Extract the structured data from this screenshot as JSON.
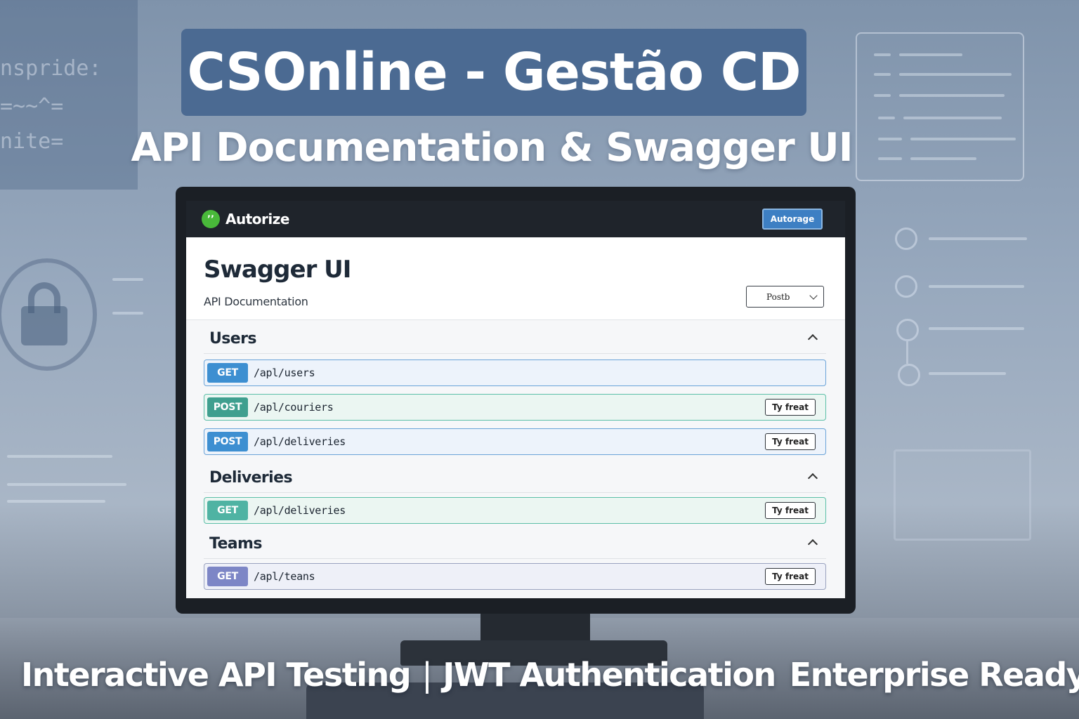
{
  "headline": {
    "title": "CSOnline - Gestão CD",
    "subtitle": "API Documentation & Swagger UI"
  },
  "features": {
    "item1": "Interactive API Testing",
    "separator": "|",
    "item2": "JWT Authentication",
    "item3": "Enterprise Ready"
  },
  "background": {
    "code_lines": [
      "nspride:",
      "=~~^=",
      "nite="
    ]
  },
  "swagger": {
    "brand": "Autorize",
    "authorize_label": "Autorage",
    "title": "Swagger UI",
    "description": "API Documentation",
    "server_value": "Postb",
    "try_label": "Ty freat",
    "sections": [
      {
        "name": "Users",
        "operations": [
          {
            "method": "GET",
            "path": "/apl/users",
            "has_try": false
          },
          {
            "method": "POST",
            "path": "/apl/couriers",
            "has_try": true
          },
          {
            "method": "POST",
            "path": "/apl/deliveries",
            "has_try": true
          }
        ]
      },
      {
        "name": "Deliveries",
        "operations": [
          {
            "method": "GET",
            "path": "/apl/deliveries",
            "has_try": true
          }
        ]
      },
      {
        "name": "Teams",
        "operations": [
          {
            "method": "GET",
            "path": "/apl/teans",
            "has_try": true
          }
        ]
      }
    ]
  },
  "colors": {
    "title_box": "#4b6a92",
    "topbar": "#1f242b",
    "authorize_button": "#3d7fc3",
    "logo": "#49b93a",
    "method_get_blue": "#3d8fd1",
    "method_post_teal": "#3f9f8f",
    "method_get_purple": "#7d86c6"
  }
}
